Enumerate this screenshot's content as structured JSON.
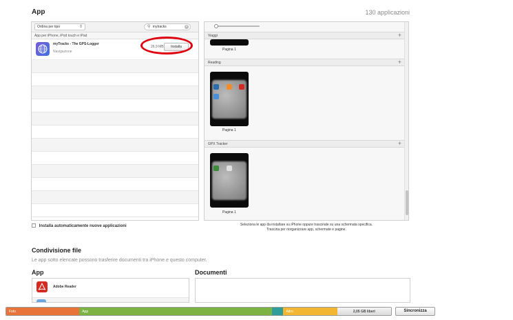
{
  "header": {
    "title": "App",
    "count": "130 applicazioni"
  },
  "apps_list": {
    "sort_label": "Ordina per tipo",
    "search_value": "mytracks",
    "section_header": "App per iPhone, iPod touch e iPad",
    "items": [
      {
        "name": "myTracks - The GPS-Logger",
        "category": "Navigazione",
        "size": "26,9 MB",
        "button": "Installa"
      }
    ],
    "auto_install_label": "Installa automaticamente nuove applicazioni"
  },
  "home_screens": {
    "sections": [
      {
        "name": "Viaggi",
        "page_label": "Pagina 1"
      },
      {
        "name": "Reading",
        "page_label": "Pagina 1"
      },
      {
        "name": "GPX Tracker",
        "page_label": "Pagina 1"
      }
    ],
    "hint_line1": "Seleziona le app da installare su iPhone oppure trascinale su una schermata specifica.",
    "hint_line2": "Trascina per riorganizzare app, schermate e pagine."
  },
  "file_sharing": {
    "title": "Condivisione file",
    "subtitle": "Le app sotto elencate possono trasferire documenti tra iPhone e questo computer.",
    "apps_header": "App",
    "docs_header": "Documenti",
    "apps": [
      {
        "name": "Adobe Reader"
      }
    ]
  },
  "capacity": {
    "segments": [
      {
        "label": "Foto",
        "color": "#e8743a",
        "share": 0.19
      },
      {
        "label": "App",
        "color": "#7cb342",
        "share": 0.5
      },
      {
        "label": "",
        "color": "#2f9d9a",
        "share": 0.03
      },
      {
        "label": "Altro",
        "color": "#f2b632",
        "share": 0.14
      }
    ],
    "free_label": "2,05 GB liberi",
    "free_share": 0.14
  },
  "sync_button": "Sincronizza",
  "colors": {
    "annotation_ring": "#e1000f"
  }
}
